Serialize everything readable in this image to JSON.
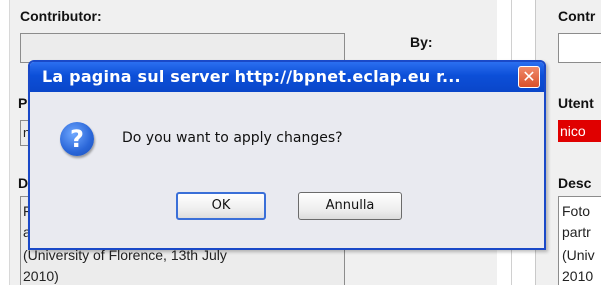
{
  "form_left": {
    "contributor_label": "Contributor:",
    "by_label": "By:",
    "p_label_fragment": "P",
    "p_field_fragment": "n",
    "d_label_fragment": "D",
    "d_line1_fragment": "F",
    "d_line2_fragment": "a",
    "description_line3": "(University of Florence, 13th July",
    "description_line4": "2010)"
  },
  "form_right": {
    "contributor_label": "Contr",
    "user_label": "Utent",
    "user_value": "nico",
    "description_label": "Desc",
    "description_lines": [
      "Foto",
      "partr",
      "(Univ",
      "2010"
    ]
  },
  "dialog": {
    "title": "La pagina sul server http://bpnet.eclap.eu r...",
    "message": "Do you want to apply changes?",
    "ok_label": "OK",
    "cancel_label": "Annulla",
    "close_glyph": "✕",
    "icon_glyph": "?",
    "icon": "question-icon"
  },
  "colors": {
    "titlebar": "#0c4fd8",
    "user_field_bg": "#e00000",
    "panel_bg": "#f0f0f0"
  }
}
